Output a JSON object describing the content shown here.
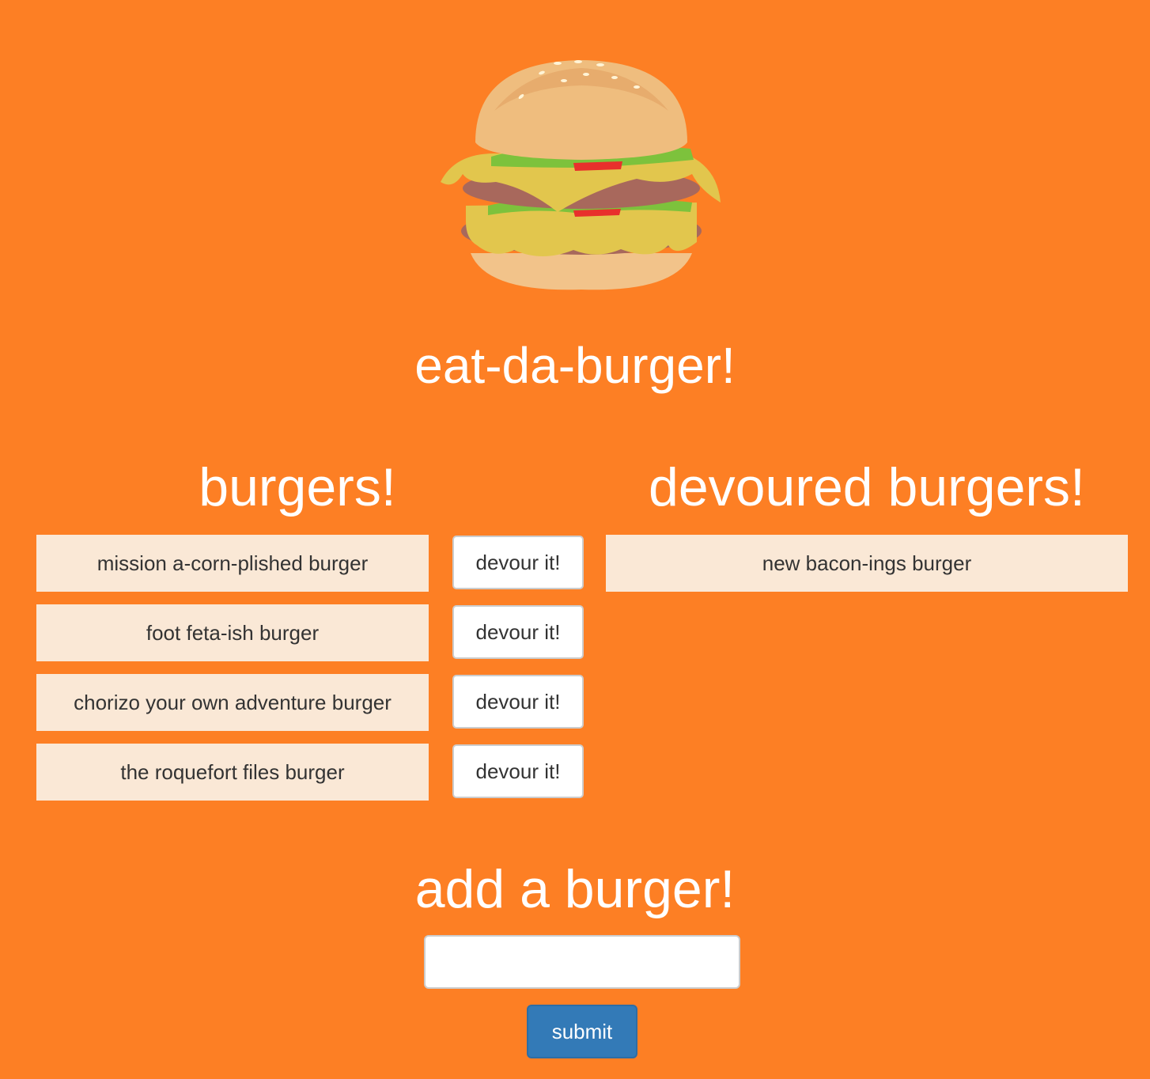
{
  "app": {
    "title": "eat-da-burger!"
  },
  "burgers": {
    "heading": "burgers!",
    "items": [
      {
        "name": "mission a-corn-plished burger",
        "action": "devour it!"
      },
      {
        "name": "foot feta-ish burger",
        "action": "devour it!"
      },
      {
        "name": "chorizo your own adventure burger",
        "action": "devour it!"
      },
      {
        "name": "the roquefort files burger",
        "action": "devour it!"
      }
    ]
  },
  "devoured": {
    "heading": "devoured burgers!",
    "items": [
      {
        "name": "new bacon-ings burger"
      }
    ]
  },
  "add": {
    "heading": "add a burger!",
    "input_value": "",
    "input_placeholder": "",
    "submit_label": "submit"
  },
  "logo": {
    "icon": "burger-icon"
  },
  "colors": {
    "background": "#fd7f24",
    "item_background": "#fae8d6",
    "submit_button": "#337ab7"
  }
}
